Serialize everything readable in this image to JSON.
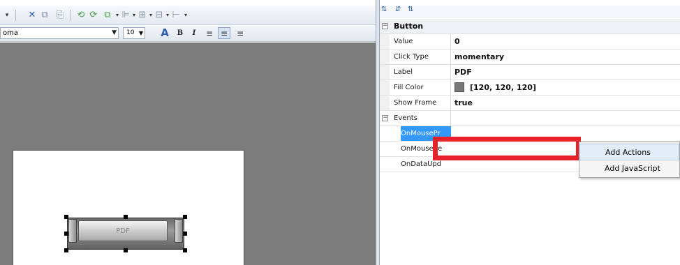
{
  "toolbar": {
    "icons": [
      "dropdown-icon",
      "cut-icon",
      "copy-icon",
      "paste-icon",
      "group-icon",
      "ungroup-icon",
      "arrange-icon",
      "align-icon",
      "grid-icon",
      "distribute-icon",
      "spacing-icon"
    ]
  },
  "format_bar": {
    "font_name": "oma",
    "font_size": "10",
    "bold_label": "B",
    "italic_label": "I"
  },
  "canvas": {
    "widget_label": "PDF"
  },
  "property_grid": {
    "toolbar_icons": [
      "sort-categorized-icon",
      "sort-alpha-icon",
      "properties-icon"
    ],
    "category": "Button",
    "rows": [
      {
        "name": "Value",
        "value": "0"
      },
      {
        "name": "Click Type",
        "value": "momentary"
      },
      {
        "name": "Label",
        "value": "PDF"
      },
      {
        "name": "Fill Color",
        "value": "[120, 120, 120]"
      },
      {
        "name": "Show Frame",
        "value": "true"
      }
    ],
    "fill_color_hex": "#787878",
    "events_label": "Events",
    "events": [
      "OnMousePr",
      "OnMouseRe",
      "OnDataUpd"
    ]
  },
  "context_menu": {
    "items": [
      "Add Actions",
      "Add JavaScript"
    ]
  },
  "highlight_color": "#e8202a"
}
